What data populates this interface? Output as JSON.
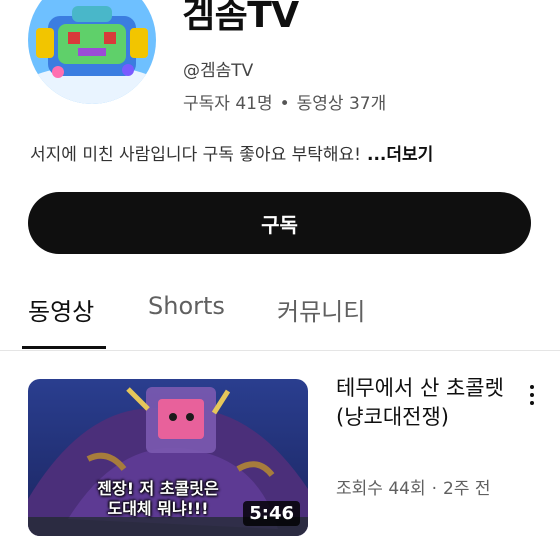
{
  "channel": {
    "name": "겜솜TV",
    "handle": "@겜솜TV",
    "subscribers": "구독자 41명",
    "videos": "동영상 37개",
    "separator": "•",
    "description": "서지에 미친 사람입니다 구독 좋아요 부탁해요!",
    "more_label": "...더보기"
  },
  "subscribe_label": "구독",
  "tabs": [
    {
      "label": "동영상",
      "active": true
    },
    {
      "label": "Shorts",
      "active": false
    },
    {
      "label": "커뮤니티",
      "active": false
    }
  ],
  "video": {
    "title": "테무에서 산 초콜렛(냥코대전쟁)",
    "views": "조회수 44회",
    "separator": "·",
    "age": "2주 전",
    "duration": "5:46",
    "thumbnail_caption_line1": "젠장! 저 초콜릿은",
    "thumbnail_caption_line2": "도대체 뭐냐!!!",
    "more_icon": "more-vert-icon"
  }
}
